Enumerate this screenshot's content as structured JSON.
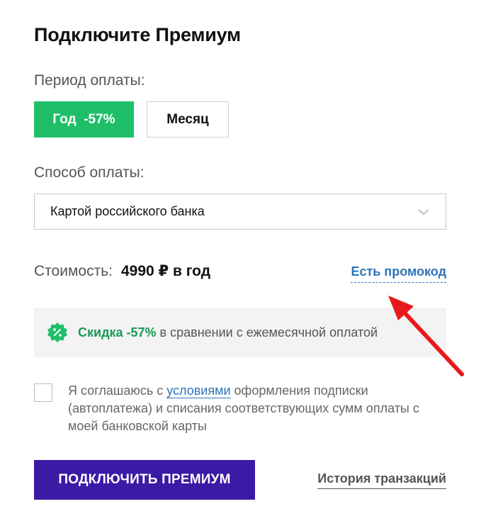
{
  "title": "Подключите Премиум",
  "period": {
    "label": "Период оплаты:",
    "options": [
      {
        "label": "Год  -57%",
        "selected": true
      },
      {
        "label": "Месяц",
        "selected": false
      }
    ]
  },
  "payment_method": {
    "label": "Способ оплаты:",
    "selected": "Картой российского банка"
  },
  "price": {
    "label": "Стоимость:",
    "value": "4990 ₽ в год"
  },
  "promo_link": "Есть промокод",
  "discount": {
    "strong": "Скидка -57%",
    "rest": "в сравнении с ежемесячной оплатой"
  },
  "agreement": {
    "before": "Я соглашаюсь с ",
    "link": "условиями",
    "after": " оформления подписки (автоплатежа) и списания соответствующих сумм оплаты с моей банковской карты"
  },
  "submit_label": "ПОДКЛЮЧИТЬ ПРЕМИУМ",
  "history_link": "История транзакций",
  "colors": {
    "green": "#1fbf6a",
    "purple": "#3b1aa6",
    "link": "#2f74b9",
    "arrow": "#e8191c"
  }
}
